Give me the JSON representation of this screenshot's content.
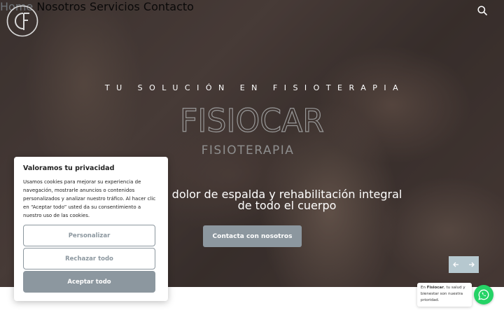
{
  "header": {
    "logo_icon": "cf-monogram-logo",
    "nav": [
      {
        "label": "Home",
        "active": true
      },
      {
        "label": "Nosotros",
        "active": false
      },
      {
        "label": "Servicios",
        "active": false
      },
      {
        "label": "Contacto",
        "active": false
      }
    ],
    "search_icon": "search-icon"
  },
  "hero": {
    "tagline": "TU SOLUCIÓN EN FISIOTERAPIA",
    "brand_name": "FISIOCAR",
    "brand_sub": "FISIOTERAPIA",
    "headline_line1": "dolor de espalda y rehabilitación integral",
    "headline_line2": "de todo el cuerpo",
    "cta_label": "Contacta con nosotros",
    "slider_prev_icon": "arrow-left-icon",
    "slider_next_icon": "arrow-right-icon"
  },
  "cookie_banner": {
    "title": "Valoramos tu privacidad",
    "text": "Usamos cookies para mejorar su experiencia de navegación, mostrarle anuncios o contenidos personalizados y analizar nuestro tráfico. Al hacer clic en “Aceptar todo” usted da su consentimiento a nuestro uso de las cookies.",
    "customize_label": "Personalizar",
    "reject_label": "Rechazar todo",
    "accept_label": "Aceptar todo"
  },
  "chat": {
    "prefix": "En ",
    "brand": "Fisiocar",
    "message": ", tu salud y bienestar son nuestra prioridad.",
    "icon": "whatsapp-icon"
  },
  "colors": {
    "accent": "#8c979f",
    "nav_active": "#9aa4ab",
    "whatsapp": "#25d366",
    "slider_bg": "#b6c8cf"
  }
}
